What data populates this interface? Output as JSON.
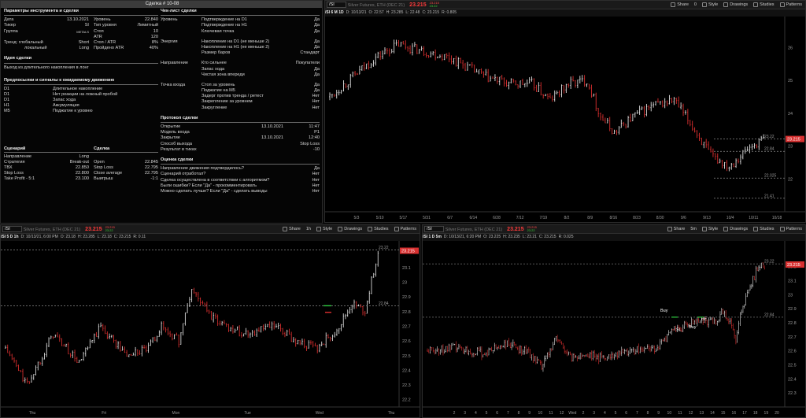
{
  "journal": {
    "title": "Сделка # 10-08",
    "params": {
      "heading": "Параметры инструмента и сделки",
      "rows": [
        [
          "Дата",
          "13.10.2021",
          "Уровень",
          "22.840"
        ],
        [
          "Тикер",
          "SI",
          "Тип уровня",
          "Лимитный"
        ],
        [
          "Группа",
          "METALS",
          "Стоп",
          "10"
        ],
        [
          "",
          "",
          "ATR",
          "120"
        ],
        [
          "Тренд:  глобальный",
          "Short",
          "Стоп / ATR",
          "8%"
        ],
        [
          "локальный",
          "Long",
          "Пройдено ATR",
          "40%"
        ]
      ]
    },
    "idea": {
      "heading": "Идея сделки",
      "text": "Выход из длительного накопления в лонг"
    },
    "signals": {
      "heading": "Предпосылки и сигналы к ожидаемому движению",
      "rows": [
        [
          "D1",
          "Длительное накопление"
        ],
        [
          "D1",
          "Нет реакции на ложный пробой"
        ],
        [
          "D1",
          "Запас хода"
        ],
        [
          "H1",
          "Аккумуляция"
        ],
        [
          "M5",
          "Поджатие к уровню"
        ]
      ]
    },
    "scenario": {
      "heading": "Сценарий",
      "heading2": "Сделка",
      "rows": [
        [
          "Направление",
          "Long",
          "",
          ""
        ],
        [
          "Стратегия",
          "Break-out",
          "Open",
          "22.845"
        ],
        [
          "ТВХ",
          "22.850",
          "Stop Loss",
          "22.795"
        ],
        [
          "Stop Loss",
          "22.800",
          "Close average",
          "22.795"
        ],
        [
          "Take Profit - 5:1",
          "23.100",
          "Выигрыш",
          "-1:1"
        ]
      ]
    },
    "checklist": {
      "heading": "Чек-лист сделки",
      "groups": [
        {
          "label": "Уровень",
          "rows": [
            [
              "Подтверждение на D1",
              "Да"
            ],
            [
              "Подтверждение на H1",
              "Да"
            ],
            [
              "Ключевая точка",
              "Да"
            ]
          ]
        },
        {
          "label": "Энергия",
          "rows": [
            [
              "Накопление на D1 (не меньше 2)",
              "Да"
            ],
            [
              "Накопление на H1 (не меньше 2)",
              "Да"
            ],
            [
              "Размер баров",
              "Стандарт"
            ]
          ]
        },
        {
          "label": "Направление",
          "rows": [
            [
              "Кто сильнее",
              "Покупатели"
            ],
            [
              "Запас хода",
              "Да"
            ],
            [
              "Чистая зона впереди",
              "Да"
            ]
          ]
        },
        {
          "label": "Точка входа",
          "rows": [
            [
              "Стоп за уровень",
              "Да"
            ],
            [
              "Поджатие на M5",
              "Да"
            ],
            [
              "Задерг против тренда / ретест",
              "Нет"
            ],
            [
              "Закрепление за уровнем",
              "Нет"
            ],
            [
              "Закругление",
              "Нет"
            ]
          ]
        }
      ]
    },
    "protocol": {
      "heading": "Протокол сделки",
      "rows": [
        [
          "Открытие",
          "13.10.2021",
          "11:47"
        ],
        [
          "Модель входа",
          "",
          "P1"
        ],
        [
          "Закрытие",
          "13.10.2021",
          "12:40"
        ],
        [
          "Способ выхода",
          "",
          "Stop Loss"
        ],
        [
          "Результат в тиках",
          "",
          "-10"
        ]
      ]
    },
    "evaluation": {
      "heading": "Оценка сделки",
      "rows": [
        [
          "Направление движения подтвердилось?",
          "Да"
        ],
        [
          "Сценарий отработал?",
          "Нет"
        ],
        [
          "Сделка осуществлена в соответствии с алгоритмом?",
          "Нет"
        ],
        [
          "Были ошибки? Если \"Да\" - прокомментировать",
          "Нет"
        ],
        [
          "Можно сделать лучше? Если \"Да\" - сделать выводы",
          "Нет"
        ]
      ]
    }
  },
  "charts": [
    {
      "id": "d1",
      "symbol": "/SI",
      "description": "Silver Futures, ETH (DEC 21)",
      "last": "23.215",
      "bid": "23.215",
      "ask": "23.22",
      "period": "",
      "info": [
        "/SI 6 M 1D",
        "D: 10/13/21",
        "O: 22.57",
        "H: 23.285",
        "L: 22.48",
        "C: 23.215",
        "R: 0.805"
      ],
      "buttons": [
        "Share",
        "Style",
        "Drawings",
        "Studies",
        "Patterns"
      ],
      "count": "0",
      "price_ticks": [
        "26",
        "25",
        "24",
        "23",
        "22"
      ],
      "x_ticks": [
        "5/3",
        "5/10",
        "5/17",
        "5/31",
        "6/7",
        "6/14",
        "6/28",
        "7/12",
        "7/19",
        "8/2",
        "8/9",
        "8/16",
        "8/23",
        "8/30",
        "9/6",
        "9/13",
        "10/4",
        "10/11",
        "10/18"
      ],
      "levels": [
        {
          "label": "23.22",
          "y": 23.22,
          "style": "dashed"
        },
        {
          "label": "22.84",
          "y": 22.84,
          "style": "dashed"
        },
        {
          "label": "22.025",
          "y": 22.025,
          "style": "dashed"
        },
        {
          "label": "21.41",
          "y": 21.41,
          "style": "dashed"
        }
      ],
      "price_tag": "23.215",
      "chart_data": {
        "type": "candlestick",
        "ylim": [
          21.0,
          26.8
        ],
        "waypoints": [
          [
            0,
            24.5
          ],
          [
            10,
            25.1
          ],
          [
            20,
            25.7
          ],
          [
            30,
            26.1
          ],
          [
            40,
            25.9
          ],
          [
            52,
            25.7
          ],
          [
            60,
            25.4
          ],
          [
            68,
            25.1
          ],
          [
            78,
            24.9
          ],
          [
            88,
            24.9
          ],
          [
            96,
            24.4
          ],
          [
            104,
            24.9
          ],
          [
            112,
            25.0
          ],
          [
            118,
            23.9
          ],
          [
            124,
            23.4
          ],
          [
            132,
            23.9
          ],
          [
            140,
            24.2
          ],
          [
            150,
            24.4
          ],
          [
            158,
            23.6
          ],
          [
            166,
            22.7
          ],
          [
            174,
            22.4
          ],
          [
            182,
            22.9
          ],
          [
            189,
            23.215
          ]
        ]
      }
    },
    {
      "id": "h1",
      "symbol": "/SI",
      "description": "Silver Futures, ETH (DEC 21)",
      "last": "23.215",
      "bid": "23.215",
      "ask": "23.22",
      "period": "1h",
      "info": [
        "/SI 5 D 1h",
        "D: 10/13/21, 6:00 PM",
        "O: 23.18",
        "H: 23.285",
        "L: 23.18",
        "C: 23.215",
        "R: 0.11"
      ],
      "buttons": [
        "Share",
        "Style",
        "Drawings",
        "Studies",
        "Patterns"
      ],
      "price_ticks": [
        "23.1",
        "23",
        "22.9",
        "22.8",
        "22.7",
        "22.6",
        "22.5",
        "22.4",
        "22.3",
        "22.2"
      ],
      "x_ticks": [
        "Thu",
        "Fri",
        "Mon",
        "Tue",
        "Wed",
        "Thu"
      ],
      "levels": [
        {
          "label": "23.22",
          "y": 23.22,
          "style": "dashed"
        },
        {
          "label": "22.84",
          "y": 22.84,
          "style": "dashed"
        }
      ],
      "price_tag": "23.215",
      "chart_data": {
        "type": "candlestick",
        "ylim": [
          22.15,
          23.25
        ],
        "waypoints": [
          [
            0,
            22.55
          ],
          [
            10,
            22.3
          ],
          [
            22,
            22.65
          ],
          [
            34,
            22.45
          ],
          [
            44,
            22.7
          ],
          [
            56,
            22.5
          ],
          [
            66,
            22.55
          ],
          [
            72,
            22.7
          ],
          [
            80,
            22.6
          ],
          [
            86,
            22.95
          ],
          [
            96,
            22.75
          ],
          [
            110,
            22.65
          ],
          [
            124,
            22.7
          ],
          [
            134,
            22.6
          ],
          [
            144,
            22.55
          ],
          [
            154,
            22.7
          ],
          [
            160,
            22.85
          ],
          [
            166,
            22.8
          ],
          [
            172,
            23.215
          ]
        ]
      }
    },
    {
      "id": "m5",
      "symbol": "/SI",
      "description": "Silver Futures, ETH (DEC 21)",
      "last": "23.215",
      "bid": "23.215",
      "ask": "23.22",
      "period": "5m",
      "info": [
        "/SI 1 D 5m",
        "D: 10/13/21, 6:20 PM",
        "O: 23.225",
        "H: 23.235",
        "L: 23.21",
        "C: 23.215",
        "R: 0.025"
      ],
      "buttons": [
        "Share",
        "Style",
        "Drawings",
        "Studies",
        "Patterns"
      ],
      "price_ticks": [
        "23.2",
        "23.1",
        "23",
        "22.9",
        "22.8",
        "22.7",
        "22.6",
        "22.5",
        "22.4",
        "22.3"
      ],
      "x_ticks": [
        "2",
        "3",
        "4",
        "5",
        "6",
        "7",
        "8",
        "9",
        "10",
        "11",
        "12",
        "Wed",
        "2",
        "3",
        "4",
        "5",
        "6",
        "7",
        "8",
        "9",
        "10",
        "11",
        "12",
        "13",
        "14",
        "15",
        "16",
        "17",
        "18",
        "19",
        "20"
      ],
      "levels": [
        {
          "label": "23.22",
          "y": 23.22,
          "style": "dashed"
        },
        {
          "label": "22.84",
          "y": 22.84,
          "style": "dashed"
        }
      ],
      "price_tag": "23.215",
      "annotations": [
        "Buy",
        "SL",
        "Buy",
        "BE"
      ],
      "chart_data": {
        "type": "candlestick",
        "ylim": [
          22.2,
          23.35
        ],
        "waypoints": [
          [
            0,
            22.6
          ],
          [
            20,
            22.62
          ],
          [
            40,
            22.58
          ],
          [
            55,
            22.65
          ],
          [
            70,
            22.6
          ],
          [
            80,
            22.48
          ],
          [
            90,
            22.7
          ],
          [
            100,
            22.55
          ],
          [
            110,
            22.58
          ],
          [
            120,
            22.55
          ],
          [
            140,
            22.6
          ],
          [
            160,
            22.62
          ],
          [
            170,
            22.72
          ],
          [
            180,
            22.78
          ],
          [
            190,
            22.82
          ],
          [
            200,
            22.8
          ],
          [
            206,
            22.87
          ],
          [
            212,
            22.83
          ],
          [
            216,
            22.68
          ],
          [
            220,
            22.9
          ],
          [
            226,
            23.05
          ],
          [
            232,
            23.22
          ],
          [
            236,
            23.215
          ]
        ]
      }
    }
  ],
  "colors": {
    "up": "#e8e8e8",
    "down": "#e03030",
    "level": "#8a8a8a",
    "tag": "#d83030"
  }
}
